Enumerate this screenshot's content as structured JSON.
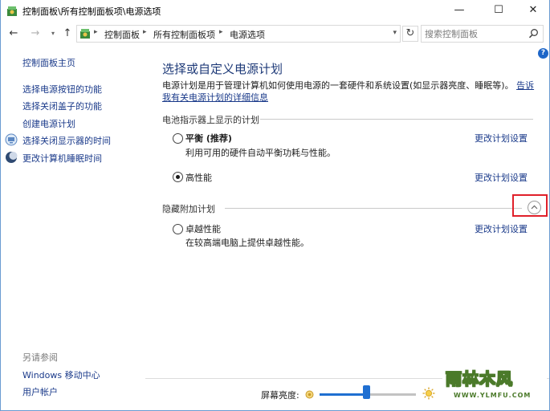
{
  "window": {
    "title": "控制面板\\所有控制面板项\\电源选项",
    "minimize": "—",
    "maximize": "☐",
    "close": "✕"
  },
  "address": {
    "crumbs": [
      "控制面板",
      "所有控制面板项",
      "电源选项"
    ],
    "search_placeholder": "搜索控制面板"
  },
  "sidebar": {
    "home": "控制面板主页",
    "items": [
      {
        "label": "选择电源按钮的功能",
        "icon": ""
      },
      {
        "label": "选择关闭盖子的功能",
        "icon": ""
      },
      {
        "label": "创建电源计划",
        "icon": ""
      },
      {
        "label": "选择关闭显示器的时间",
        "icon": "monitor-icon"
      },
      {
        "label": "更改计算机睡眠时间",
        "icon": "moon-icon"
      }
    ],
    "see_also": "另请参阅",
    "see_also_links": [
      "Windows 移动中心",
      "用户帐户"
    ]
  },
  "main": {
    "heading": "选择或自定义电源计划",
    "description": "电源计划是用于管理计算机如何使用电源的一套硬件和系统设置(如显示器亮度、睡眠等)。",
    "description_link": "告诉我有关电源计划的详细信息",
    "battery_section": "电池指示器上显示的计划",
    "plans": [
      {
        "name": "平衡 (推荐)",
        "desc": "利用可用的硬件自动平衡功耗与性能。",
        "checked": false,
        "bold": true,
        "link": "更改计划设置"
      },
      {
        "name": "高性能",
        "desc": "",
        "checked": true,
        "bold": false,
        "link": "更改计划设置"
      }
    ],
    "hidden_section": "隐藏附加计划",
    "hidden_plans": [
      {
        "name": "卓越性能",
        "desc": "在较高端电脑上提供卓越性能。",
        "checked": false,
        "link": "更改计划设置"
      }
    ],
    "brightness_label": "屏幕亮度:",
    "brightness_level_percent": 48
  },
  "watermark": {
    "main": "雨林木风",
    "sub": "WWW.YLMFU.COM"
  },
  "colors": {
    "link": "#1a3a8a",
    "heading": "#1e3a78",
    "accent": "#1f6fd1",
    "highlight": "#e0202a"
  }
}
